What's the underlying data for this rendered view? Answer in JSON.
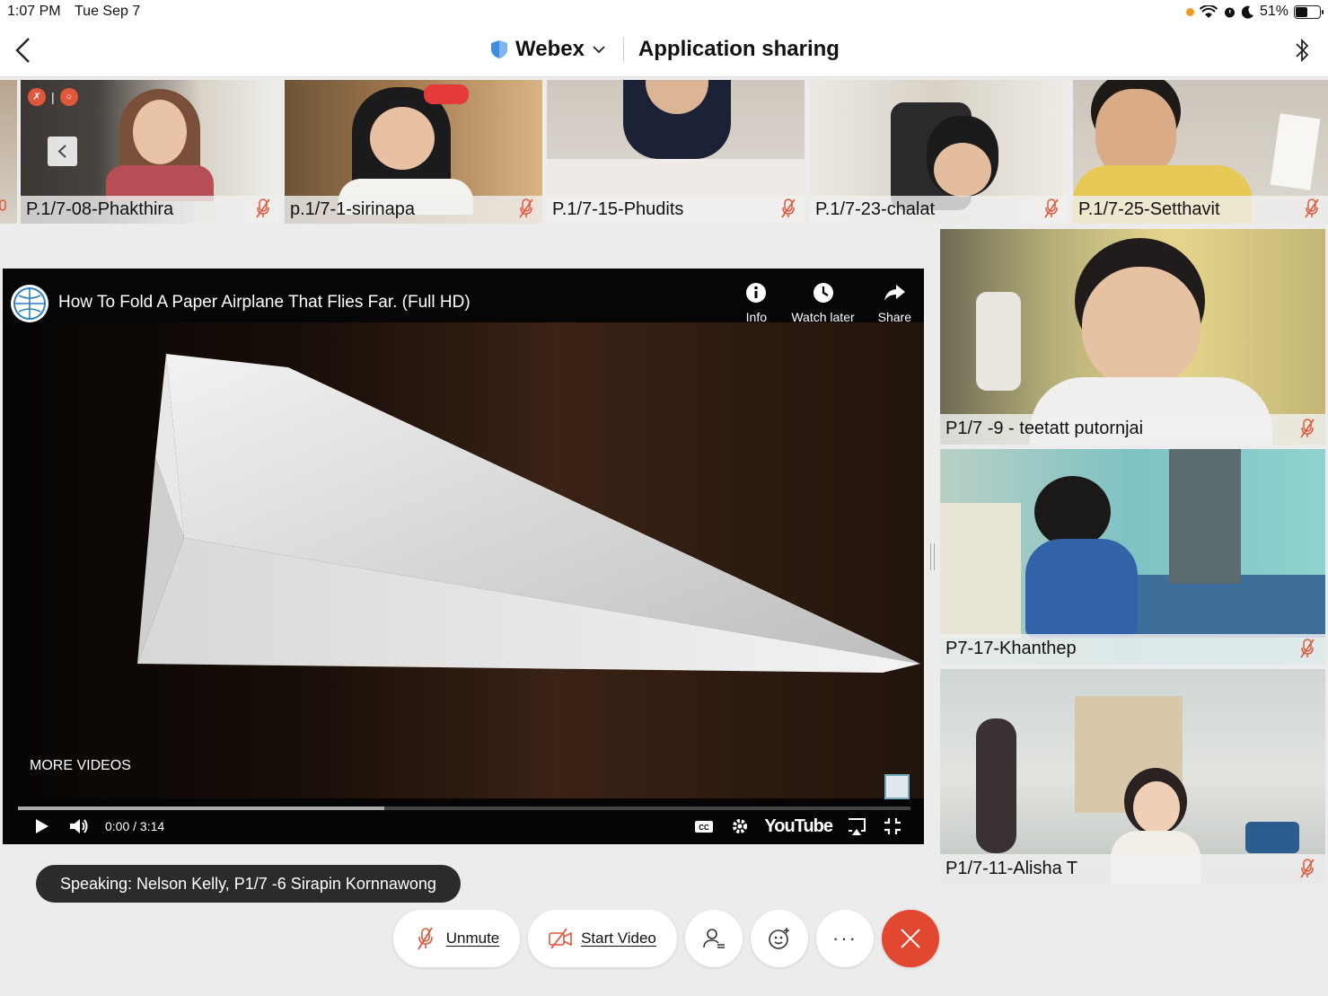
{
  "status_bar": {
    "time": "1:07 PM",
    "date": "Tue Sep 7",
    "battery": "51%",
    "battery_level": 0.51
  },
  "header": {
    "app_name": "Webex",
    "share_title": "Application sharing"
  },
  "thumbnails": [
    {
      "name": "P.1/7-08-Phakthira"
    },
    {
      "name": "p.1/7-1-sirinapa"
    },
    {
      "name": "P.1/7-15-Phudits"
    },
    {
      "name": "P.1/7-23-chalat"
    },
    {
      "name": "P.1/7-25-Setthavit"
    }
  ],
  "video": {
    "title": "How To Fold A Paper Airplane That Flies Far. (Full HD)",
    "actions": [
      "Info",
      "Watch later",
      "Share"
    ],
    "more_videos": "MORE VIDEOS",
    "time": "0:00 / 3:14",
    "buffered": 0.41,
    "brand": "YouTube"
  },
  "side_participants": [
    {
      "name": "P1/7 -9 - teetatt putornjai"
    },
    {
      "name": "P7-17-Khanthep"
    },
    {
      "name": "P1/7-11-Alisha T"
    }
  ],
  "speaking": "Speaking: Nelson Kelly, P1/7 -6 Sirapin Kornnawong",
  "controls": {
    "unmute": "Unmute",
    "start_video": "Start Video",
    "more": "···"
  },
  "colors": {
    "accent_red": "#e2472f",
    "mic_muted": "#e0573c",
    "shield_blue": "#3d8ee0"
  }
}
